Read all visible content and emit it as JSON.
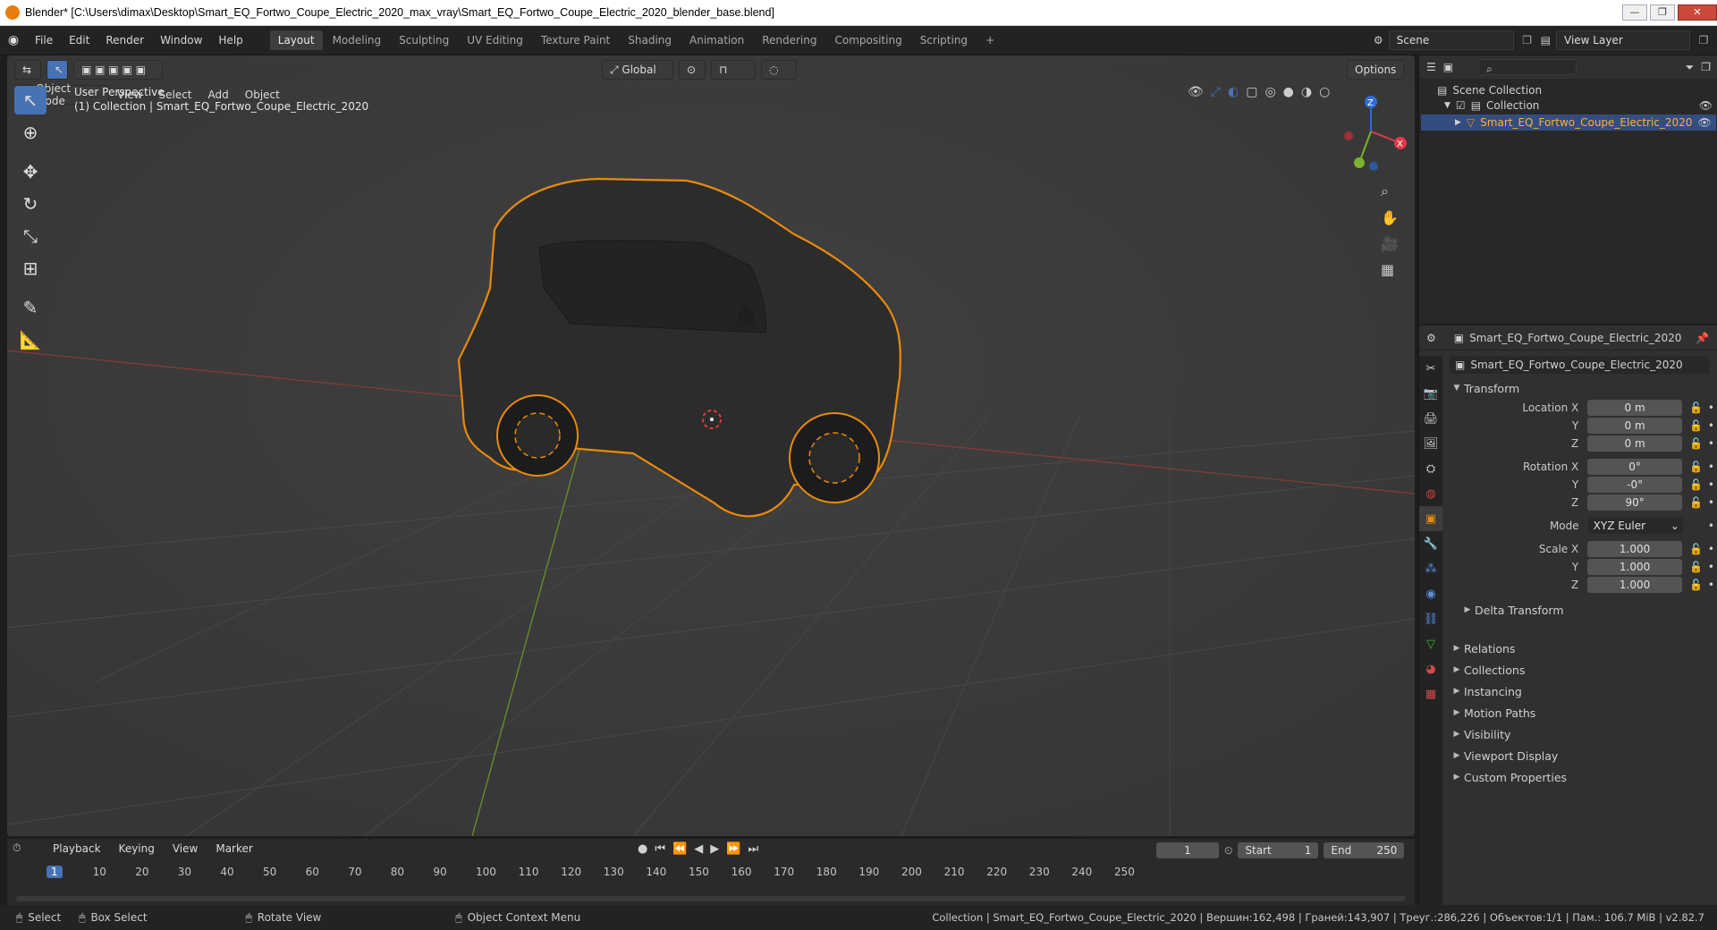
{
  "window": {
    "title": "Blender* [C:\\Users\\dimax\\Desktop\\Smart_EQ_Fortwo_Coupe_Electric_2020_max_vray\\Smart_EQ_Fortwo_Coupe_Electric_2020_blender_base.blend]",
    "minimize": "—",
    "maximize": "❐",
    "close": "✕"
  },
  "menus": [
    "File",
    "Edit",
    "Render",
    "Window",
    "Help"
  ],
  "workspaces": [
    "Layout",
    "Modeling",
    "Sculpting",
    "UV Editing",
    "Texture Paint",
    "Shading",
    "Animation",
    "Rendering",
    "Compositing",
    "Scripting",
    "+"
  ],
  "scene": {
    "label": "Scene",
    "view_layer": "View Layer"
  },
  "viewport": {
    "mode": "Object Mode",
    "menus": [
      "View",
      "Select",
      "Add",
      "Object"
    ],
    "orientation": "Global",
    "options": "Options",
    "overlay_line1": "User Perspective",
    "overlay_line2": "(1) Collection | Smart_EQ_Fortwo_Coupe_Electric_2020",
    "axes": {
      "x": "X",
      "y": "Y",
      "z": "Z"
    }
  },
  "outliner": {
    "search_placeholder": "",
    "scene_collection": "Scene Collection",
    "collection": "Collection",
    "object": "Smart_EQ_Fortwo_Coupe_Electric_2020"
  },
  "properties": {
    "header_object": "Smart_EQ_Fortwo_Coupe_Electric_2020",
    "object_name": "Smart_EQ_Fortwo_Coupe_Electric_2020",
    "transform": "Transform",
    "location_label": "Location X",
    "loc": [
      "0 m",
      "0 m",
      "0 m"
    ],
    "rotation_label": "Rotation X",
    "rot": [
      "0°",
      "-0°",
      "90°"
    ],
    "mode_label": "Mode",
    "mode_value": "XYZ Euler",
    "scale_label": "Scale X",
    "scale": [
      "1.000",
      "1.000",
      "1.000"
    ],
    "y": "Y",
    "z": "Z",
    "delta": "Delta Transform",
    "panels": [
      "Relations",
      "Collections",
      "Instancing",
      "Motion Paths",
      "Visibility",
      "Viewport Display",
      "Custom Properties"
    ]
  },
  "timeline": {
    "menus": [
      "Playback",
      "Keying",
      "View",
      "Marker"
    ],
    "current_frame": "1",
    "start_label": "Start",
    "start": "1",
    "end_label": "End",
    "end": "250",
    "ticks": [
      "1",
      "10",
      "20",
      "30",
      "40",
      "50",
      "60",
      "70",
      "80",
      "90",
      "100",
      "110",
      "120",
      "130",
      "140",
      "150",
      "160",
      "170",
      "180",
      "190",
      "200",
      "210",
      "220",
      "230",
      "240",
      "250"
    ]
  },
  "status": {
    "select": "Select",
    "box_select": "Box Select",
    "rotate_view": "Rotate View",
    "context_menu": "Object Context Menu",
    "stats": "Collection | Smart_EQ_Fortwo_Coupe_Electric_2020 | Вершин:162,498 | Граней:143,907 | Треуг.:286,226 | Объектов:1/1 | Пам.: 106.7 MiB | v2.82.7"
  },
  "colors": {
    "accent": "#4772b3",
    "selection": "#e98a0b",
    "xaxis": "#e23a4a",
    "yaxis": "#7ab22c",
    "zaxis": "#2c6fd6"
  }
}
